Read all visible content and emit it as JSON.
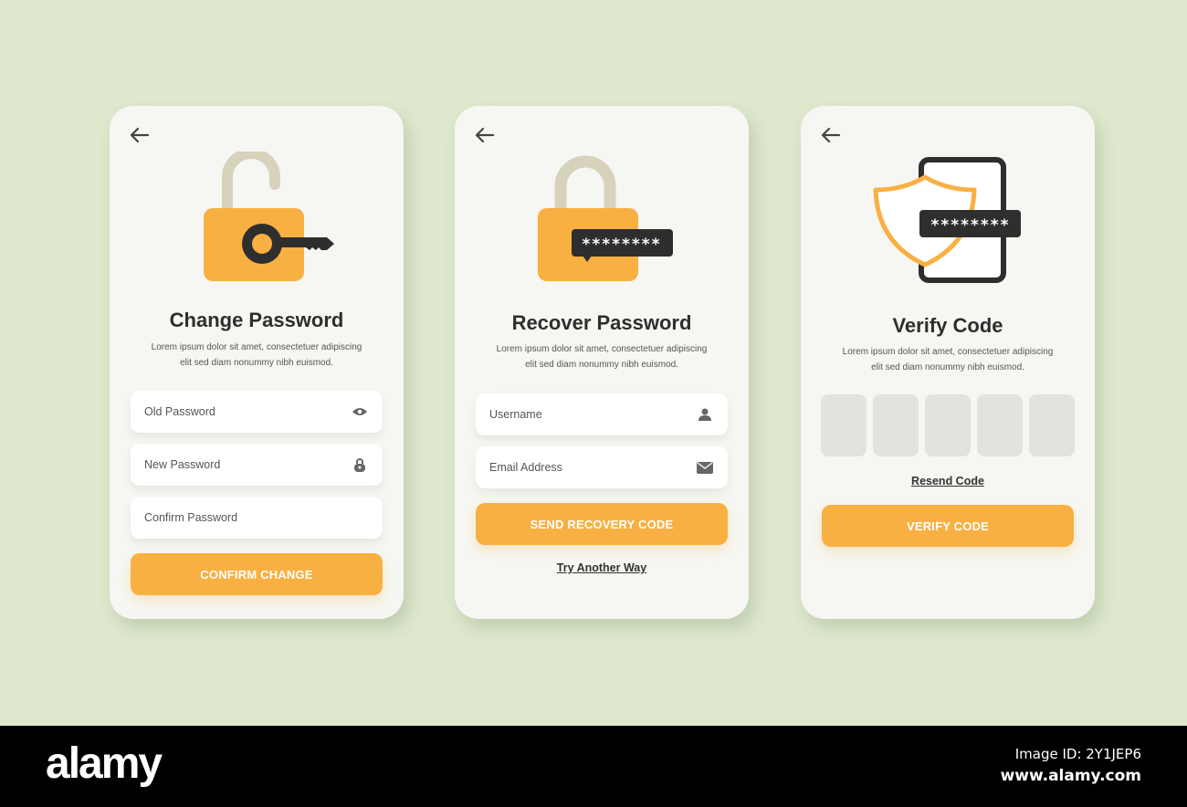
{
  "colors": {
    "background": "#dee8cd",
    "card": "#f6f7f2",
    "accent": "#f9b042",
    "dark": "#2e2e2e",
    "shackle": "#d6d2bc",
    "otp_box": "#e1e3dd"
  },
  "screens": [
    {
      "id": "change-password",
      "back_icon": "arrow-left-icon",
      "illustration": "unlocked-padlock-with-key",
      "title": "Change Password",
      "description_line1": "Lorem ipsum dolor sit amet, consectetuer adipiscing",
      "description_line2": "elit sed diam nonummy nibh euismod.",
      "fields": [
        {
          "placeholder": "Old Password",
          "icon": "eye-icon"
        },
        {
          "placeholder": "New Password",
          "icon": "lock-icon"
        },
        {
          "placeholder": "Confirm Password",
          "icon": ""
        }
      ],
      "button_label": "CONFIRM CHANGE"
    },
    {
      "id": "recover-password",
      "back_icon": "arrow-left-icon",
      "illustration": "padlock-with-password-bubble",
      "password_mask": "********",
      "title": "Recover Password",
      "description_line1": "Lorem ipsum dolor sit amet, consectetuer adipiscing",
      "description_line2": "elit sed diam nonummy nibh euismod.",
      "fields": [
        {
          "placeholder": "Username",
          "icon": "user-icon"
        },
        {
          "placeholder": "Email Address",
          "icon": "envelope-icon"
        }
      ],
      "button_label": "SEND RECOVERY CODE",
      "link_label": "Try Another Way"
    },
    {
      "id": "verify-code",
      "back_icon": "arrow-left-icon",
      "illustration": "shield-and-phone-with-password",
      "password_mask": "********",
      "title": "Verify Code",
      "description_line1": "Lorem ipsum dolor sit amet, consectetuer adipiscing",
      "description_line2": "elit sed diam nonummy nibh euismod.",
      "code_boxes": 5,
      "link_label": "Resend Code",
      "button_label": "VERIFY CODE"
    }
  ],
  "footer": {
    "logo": "alamy",
    "image_id": "Image ID: 2Y1JEP6",
    "website": "www.alamy.com"
  }
}
